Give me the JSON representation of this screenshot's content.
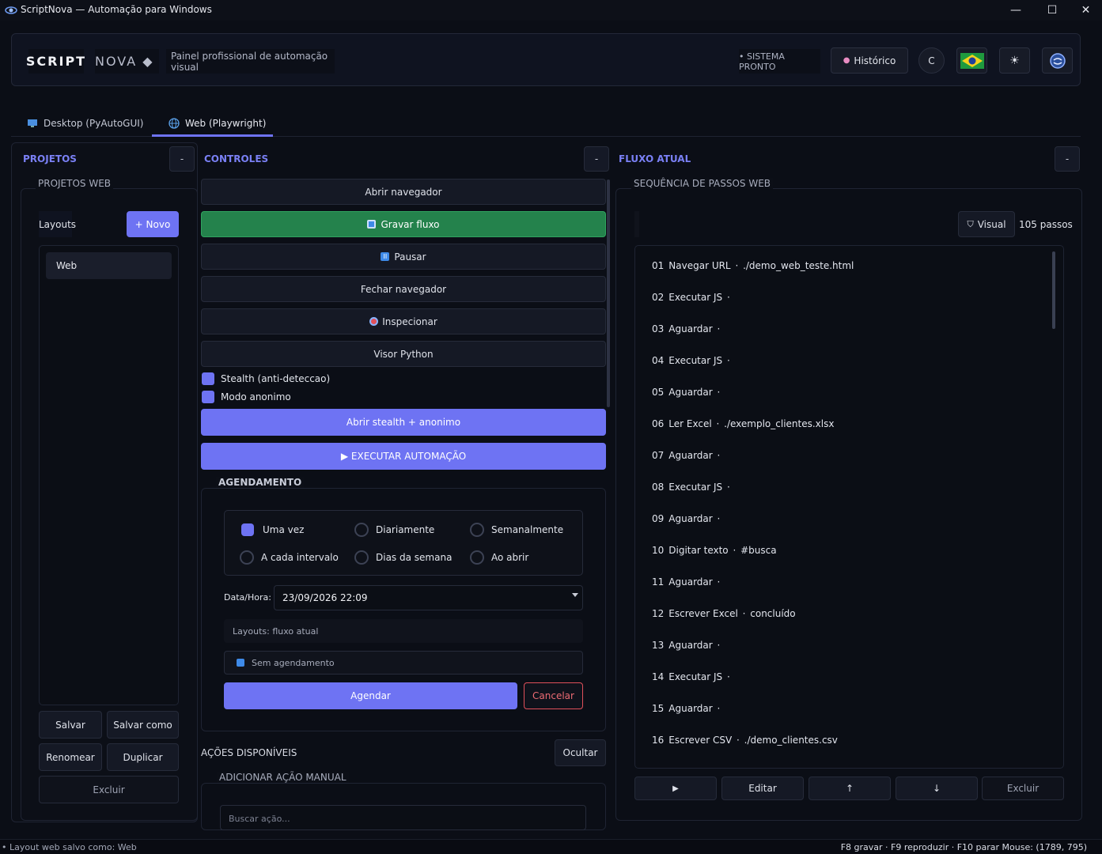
{
  "window": {
    "title": "ScriptNova — Automação para Windows",
    "minimize": "—",
    "maximize": "☐",
    "close": "✕"
  },
  "header": {
    "logo_part1": "SCRIPT",
    "logo_part2": "NOVA ◆",
    "tagline": "Painel profissional de automação visual",
    "status": "• SISTEMA PRONTO",
    "history_button": "Histórico",
    "c_button": "C",
    "theme_icon": "☀",
    "accent_color": "#6e73f3"
  },
  "tabs": [
    {
      "label": "Desktop (PyAutoGUI)",
      "icon": "monitor-icon"
    },
    {
      "label": "Web (Playwright)",
      "icon": "globe-icon"
    }
  ],
  "projects": {
    "section_title": "PROJETOS",
    "collapse": "-",
    "group_title": "PROJETOS WEB",
    "layouts_label": "Layouts",
    "new_button": "+ Novo",
    "items": [
      "Web"
    ],
    "save": "Salvar",
    "save_as": "Salvar como",
    "rename": "Renomear",
    "duplicate": "Duplicar",
    "delete": "Excluir"
  },
  "controls": {
    "section_title": "CONTROLES",
    "collapse": "-",
    "open_browser": "Abrir navegador",
    "record_flow": "Gravar fluxo",
    "pause": "Pausar",
    "close_browser": "Fechar navegador",
    "inspect": "Inspecionar",
    "python_viewer": "Visor Python",
    "stealth_label": "Stealth (anti-deteccao)",
    "incognito_label": "Modo anonimo",
    "open_stealth": "Abrir stealth + anonimo",
    "run_automation": "▶ EXECUTAR AUTOMAÇÃO",
    "success_color": "#24824c"
  },
  "schedule": {
    "title": "AGENDAMENTO",
    "options": [
      "Uma vez",
      "Diariamente",
      "Semanalmente",
      "A cada intervalo",
      "Dias da semana",
      "Ao abrir"
    ],
    "selected": "Uma vez",
    "datetime_label": "Data/Hora:",
    "datetime_value": "23/09/2026  22:09",
    "layouts_value": "Layouts: fluxo atual",
    "status_text": "Sem agendamento",
    "schedule_button": "Agendar",
    "cancel_button": "Cancelar",
    "danger_color": "#e0505a"
  },
  "actions": {
    "title": "AÇÕES DISPONÍVEIS",
    "hide_button": "Ocultar",
    "manual_title": "ADICIONAR AÇÃO MANUAL",
    "search_placeholder": "Buscar ação..."
  },
  "flow": {
    "section_title": "FLUXO ATUAL",
    "collapse": "-",
    "group_title": "SEQUÊNCIA DE PASSOS WEB",
    "visual_button": "Visual",
    "steps_count": "105 passos",
    "steps": [
      {
        "n": "01",
        "label": "Navegar URL",
        "arg": "./demo_web_teste.html"
      },
      {
        "n": "02",
        "label": "Executar JS",
        "arg": ""
      },
      {
        "n": "03",
        "label": "Aguardar",
        "arg": ""
      },
      {
        "n": "04",
        "label": "Executar JS",
        "arg": ""
      },
      {
        "n": "05",
        "label": "Aguardar",
        "arg": ""
      },
      {
        "n": "06",
        "label": "Ler Excel",
        "arg": "./exemplo_clientes.xlsx"
      },
      {
        "n": "07",
        "label": "Aguardar",
        "arg": ""
      },
      {
        "n": "08",
        "label": "Executar JS",
        "arg": ""
      },
      {
        "n": "09",
        "label": "Aguardar",
        "arg": ""
      },
      {
        "n": "10",
        "label": "Digitar texto",
        "arg": "#busca"
      },
      {
        "n": "11",
        "label": "Aguardar",
        "arg": ""
      },
      {
        "n": "12",
        "label": "Escrever Excel",
        "arg": "concluído"
      },
      {
        "n": "13",
        "label": "Aguardar",
        "arg": ""
      },
      {
        "n": "14",
        "label": "Executar JS",
        "arg": ""
      },
      {
        "n": "15",
        "label": "Aguardar",
        "arg": ""
      },
      {
        "n": "16",
        "label": "Escrever CSV",
        "arg": "./demo_clientes.csv"
      }
    ],
    "play_button": "▶",
    "edit_button": "Editar",
    "up_button": "↑",
    "down_button": "↓",
    "delete_button": "Excluir"
  },
  "statusbar": {
    "left": "• Layout web salvo como: Web",
    "right": "F8 gravar · F9 reproduzir · F10 parar  Mouse: (1789, 795)"
  }
}
